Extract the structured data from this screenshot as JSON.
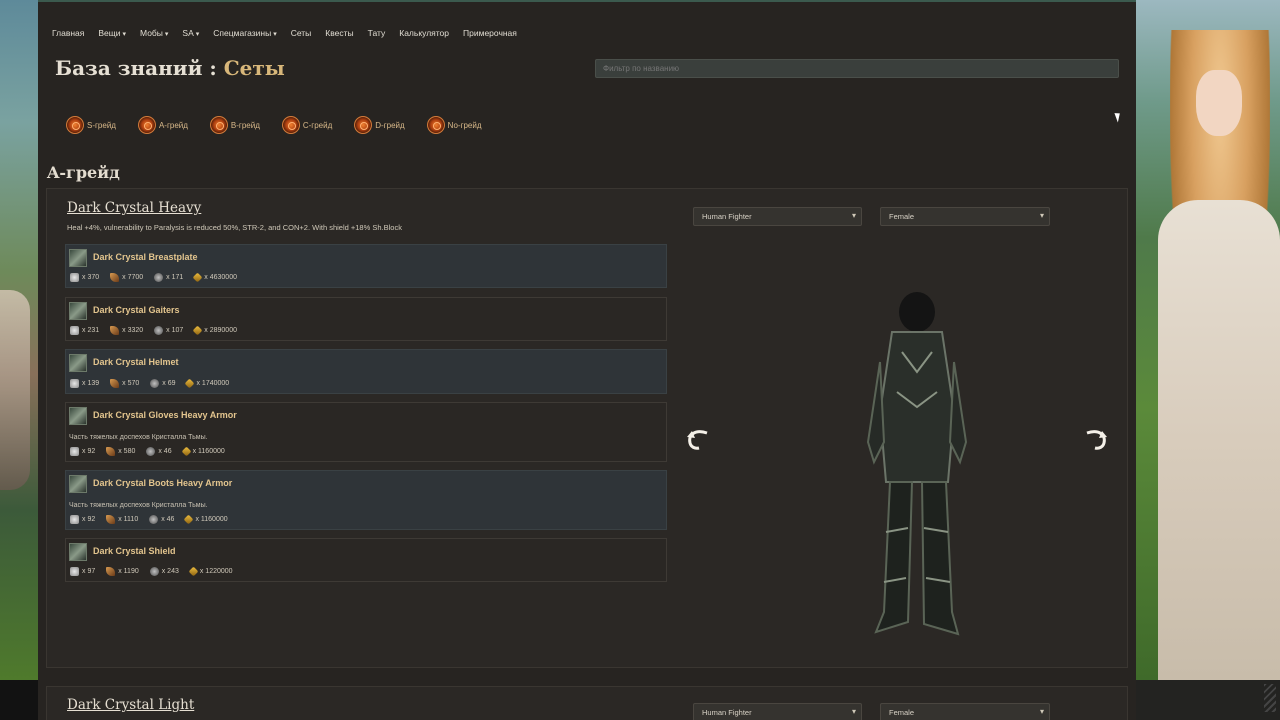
{
  "nav": {
    "items": [
      {
        "label": "Главная",
        "caret": false
      },
      {
        "label": "Вещи",
        "caret": true
      },
      {
        "label": "Мобы",
        "caret": true
      },
      {
        "label": "SA",
        "caret": true
      },
      {
        "label": "Спецмагазины",
        "caret": true
      },
      {
        "label": "Сеты",
        "caret": false
      },
      {
        "label": "Квесты",
        "caret": false
      },
      {
        "label": "Тату",
        "caret": false
      },
      {
        "label": "Калькулятор",
        "caret": false
      },
      {
        "label": "Примерочная",
        "caret": false
      }
    ],
    "caret_glyph": "▾"
  },
  "header": {
    "title_prefix": "База знаний :",
    "title_accent": "Сеты",
    "filter_placeholder": "Фильтр по названию"
  },
  "grades": [
    "S-грейд",
    "A-грейд",
    "B-грейд",
    "C-грейд",
    "D-грейд",
    "No-грейд"
  ],
  "section_title": "A-грейд",
  "sets": [
    {
      "name": "Dark Crystal Heavy",
      "description": "Heal +4%, vulnerability to Paralysis is reduced 50%, STR-2, and CON+2. With shield +18% Sh.Block",
      "race_select": "Human Fighter",
      "gender_select": "Female",
      "items": [
        {
          "name": "Dark Crystal Breastplate",
          "desc": "",
          "res": [
            "x 370",
            "x 7700",
            "x 171",
            "x 4630000"
          ]
        },
        {
          "name": "Dark Crystal Gaiters",
          "desc": "",
          "res": [
            "x 231",
            "x 3320",
            "x 107",
            "x 2890000"
          ]
        },
        {
          "name": "Dark Crystal Helmet",
          "desc": "",
          "res": [
            "x 139",
            "x 570",
            "x 69",
            "x 1740000"
          ]
        },
        {
          "name": "Dark Crystal Gloves Heavy Armor",
          "desc": "Часть тяжелых доспехов Кристалла Тьмы.",
          "res": [
            "x 92",
            "x 580",
            "x 46",
            "x 1160000"
          ]
        },
        {
          "name": "Dark Crystal Boots Heavy Armor",
          "desc": "Часть тяжелых доспехов Кристалла Тьмы.",
          "res": [
            "x 92",
            "x 1110",
            "x 46",
            "x 1160000"
          ]
        },
        {
          "name": "Dark Crystal Shield",
          "desc": "",
          "res": [
            "x 97",
            "x 1190",
            "x 243",
            "x 1220000"
          ]
        }
      ]
    },
    {
      "name": "Dark Crystal Light",
      "race_select": "Human Fighter",
      "gender_select": "Female"
    }
  ],
  "icons": {
    "rotate_left": "rotate-left-icon",
    "rotate_right": "rotate-right-icon",
    "select_arrow": "▾"
  },
  "colors": {
    "accent": "#d8b77a",
    "item_name": "#e3c58e",
    "page_bg": "#272421"
  }
}
